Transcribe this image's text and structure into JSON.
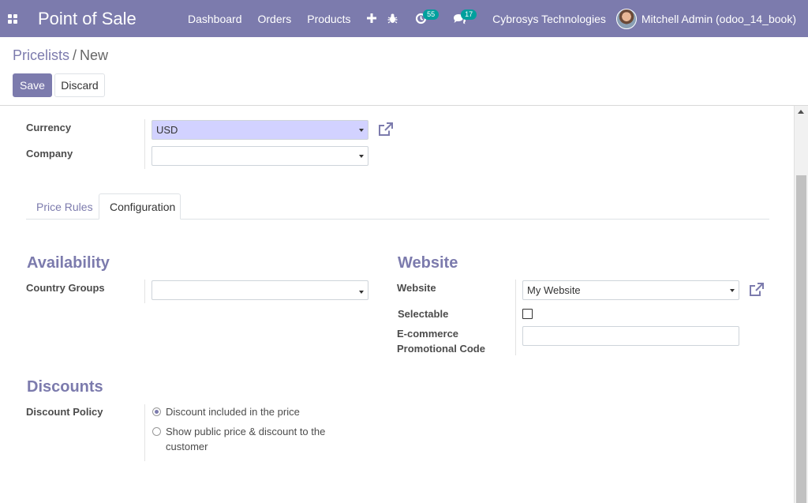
{
  "navbar": {
    "app_title": "Point of Sale",
    "menu": [
      "Dashboard",
      "Orders",
      "Products"
    ],
    "activity_count": "55",
    "message_count": "17",
    "company": "Cybrosys Technologies",
    "user": "Mitchell Admin (odoo_14_book)",
    "color": "#7c7bad"
  },
  "breadcrumb": {
    "parent": "Pricelists",
    "separator": "/",
    "current": "New"
  },
  "buttons": {
    "save": "Save",
    "discard": "Discard"
  },
  "form": {
    "currency_label": "Currency",
    "currency_value": "USD",
    "company_label": "Company",
    "company_value": ""
  },
  "tabs": [
    "Price Rules",
    "Configuration"
  ],
  "active_tab": "Configuration",
  "availability": {
    "title": "Availability",
    "country_groups_label": "Country Groups",
    "country_groups_value": ""
  },
  "website": {
    "title": "Website",
    "website_label": "Website",
    "website_value": "My Website",
    "selectable_label": "Selectable",
    "promo_label_line1": "E-commerce",
    "promo_label_line2": "Promotional Code",
    "promo_value": ""
  },
  "discounts": {
    "title": "Discounts",
    "policy_label": "Discount Policy",
    "options": [
      "Discount included in the price",
      "Show public price & discount to the customer"
    ],
    "selected_index": 0
  },
  "icons": [
    "apps-icon",
    "plus-icon",
    "bug-icon",
    "activity-icon",
    "chat-icon",
    "external-link-icon"
  ]
}
